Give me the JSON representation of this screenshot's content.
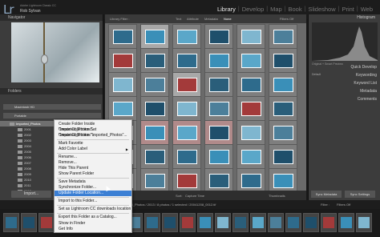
{
  "app": {
    "logo": "Lr",
    "subtitle": "Adobe Lightroom Classic CC",
    "user": "Rob Sylvan"
  },
  "modules": [
    "Library",
    "Develop",
    "Map",
    "Book",
    "Slideshow",
    "Print",
    "Web"
  ],
  "active_module": "Library",
  "left_panel": {
    "navigator_label": "Navigator",
    "folders_label": "Folders",
    "volumes": [
      "Macintosh HD",
      "Portable"
    ],
    "selected_folder": "Imported_Photos",
    "years": [
      "2001",
      "2002",
      "2003",
      "2004",
      "2005",
      "2006",
      "2007",
      "2008",
      "2009",
      "2010",
      "2011",
      "2012",
      "2013"
    ],
    "import_button": "Import..."
  },
  "center": {
    "filter_title": "Library Filter :",
    "filter_tabs": [
      "Text",
      "Attribute",
      "Metadata",
      "None"
    ],
    "filter_preset": "Filters Off",
    "sort_label": "Sort:",
    "sort_value": "Capture Time",
    "thumbnails_label": "Thumbnails"
  },
  "right_panel": {
    "histogram_label": "Histogram",
    "original_label": "Original + Smart Preview",
    "default_label": "Default",
    "quick_develop": "Quick Develop",
    "keywording": "Keywording",
    "keyword_list": "Keyword List",
    "metadata": "Metadata",
    "comments": "Comments",
    "sync_metadata": "Sync Metadata",
    "sync_settings": "Sync Settings"
  },
  "filmstrip": {
    "source": "Imported_Photos / 2013 / 8 photos / 1 selected / 20041208_0012.tif",
    "filter_label": "Filter :",
    "filter_value": "Filters Off"
  },
  "context_menu": {
    "items": [
      {
        "label": "Create Folder Inside \"Imported_Photos\"...",
        "state": "normal"
      },
      {
        "label": "Create Collection Set \"Imported_Photos\"...",
        "state": "normal"
      },
      {
        "label": "Create Collection \"Imported_Photos\"...",
        "state": "normal"
      },
      {
        "label": "Mark Favorite",
        "state": "normal"
      },
      {
        "label": "Add Color Label",
        "state": "submenu"
      },
      {
        "label": "Rename...",
        "state": "normal"
      },
      {
        "label": "Remove...",
        "state": "normal"
      },
      {
        "label": "Hide This Parent",
        "state": "normal"
      },
      {
        "label": "Show Parent Folder",
        "state": "normal"
      },
      {
        "label": "Save Metadata",
        "state": "normal"
      },
      {
        "label": "Synchronize Folder...",
        "state": "normal"
      },
      {
        "label": "Update Folder Location...",
        "state": "highlighted"
      },
      {
        "label": "Import to this Folder...",
        "state": "normal"
      },
      {
        "label": "Set as Lightroom CC downloads location",
        "state": "normal"
      },
      {
        "label": "Export this Folder as a Catalog...",
        "state": "normal"
      },
      {
        "label": "Show in Finder",
        "state": "normal"
      },
      {
        "label": "Get Info",
        "state": "normal"
      }
    ]
  },
  "colors": {
    "menu_highlight": "#3b7fd4",
    "accent_logo": "#8fa9c4"
  }
}
